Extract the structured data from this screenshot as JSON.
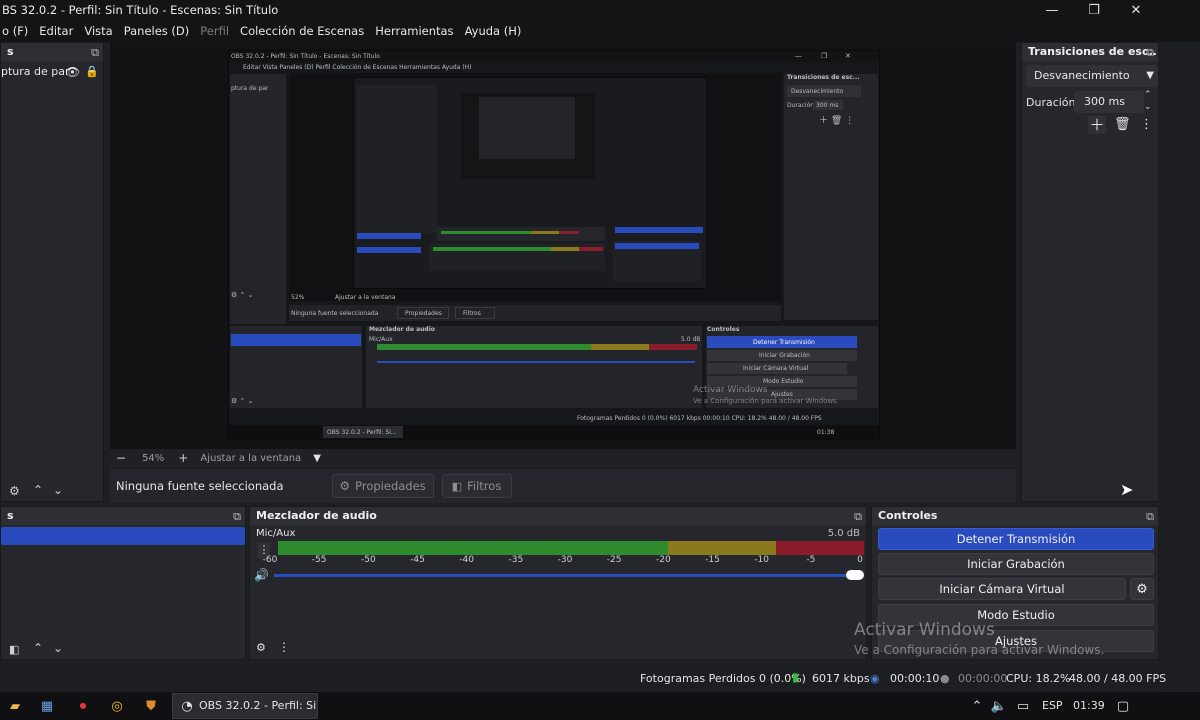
{
  "window": {
    "title": "BS 32.0.2 - Perfil: Sin Título - Escenas: Sin Título",
    "min_glyph": "—",
    "max_glyph": "❐",
    "close_glyph": "✕"
  },
  "menu": [
    {
      "label": "o (F)",
      "disabled": false
    },
    {
      "label": "Editar",
      "disabled": false
    },
    {
      "label": "Vista",
      "disabled": false
    },
    {
      "label": "Paneles (D)",
      "disabled": false
    },
    {
      "label": "Perfil",
      "disabled": true
    },
    {
      "label": "Colección de Escenas",
      "disabled": false
    },
    {
      "label": "Herramientas",
      "disabled": false
    },
    {
      "label": "Ayuda (H)",
      "disabled": false
    }
  ],
  "sources": {
    "header": "s",
    "item_label": "ptura de par"
  },
  "preview": {
    "zoom_minus": "−",
    "zoom_value": "54%",
    "zoom_plus": "+",
    "fit_label": "Ajustar a la ventana"
  },
  "source_toolbar": {
    "no_selection": "Ninguna fuente seleccionada",
    "properties": "Propiedades",
    "filters": "Filtros"
  },
  "transitions": {
    "header": "Transiciones de esc...",
    "selected": "Desvanecimiento",
    "duration_label": "Duración",
    "duration_value": "300 ms"
  },
  "scenes": {
    "header": "s"
  },
  "mixer": {
    "header": "Mezclador de audio",
    "channel": "Mic/Aux",
    "level": "5.0 dB",
    "ticks": [
      "-60",
      "-55",
      "-50",
      "-45",
      "-40",
      "-35",
      "-30",
      "-25",
      "-20",
      "-15",
      "-10",
      "-5",
      "0"
    ]
  },
  "controls": {
    "header": "Controles",
    "stop_stream": "Detener Transmisión",
    "start_recording": "Iniciar Grabación",
    "virtual_cam": "Iniciar Cámara Virtual",
    "studio_mode": "Modo Estudio",
    "settings": "Ajustes"
  },
  "watermark": {
    "line1": "Activar Windows",
    "line2": "Ve a Configuración para activar Windows."
  },
  "status": {
    "dropped": "Fotogramas Perdidos 0 (0.0%)",
    "bitrate": "6017 kbps",
    "stream_time": "00:00:10",
    "rec_time": "00:00:00",
    "cpu": "CPU: 18.2%",
    "fps": "48.00 / 48.00 FPS"
  },
  "taskbar": {
    "app_label": "OBS 32.0.2 - Perfil: Si...",
    "lang": "ESP",
    "time": "01:39"
  },
  "nested": {
    "title": "OBS 32.0.2 - Perfil: Sin Título - Escenas: Sin Título",
    "menu": "Editar   Vista   Paneles (D)   Perfil   Colección de Escenas   Herramientas   Ayuda (H)",
    "transitions": "Transiciones de esc...",
    "fade": "Desvanecimiento",
    "duration": "Duración",
    "duration_value": "300 ms",
    "no_source": "Ninguna fuente seleccionada",
    "props": "Propiedades",
    "filters": "Filtros",
    "mixer": "Mezclador de audio",
    "mic": "Mic/Aux",
    "level": "5.0 dB",
    "controls": "Controles",
    "stop": "Detener Transmisión",
    "rec": "Iniciar Grabación",
    "cam": "Iniciar Cámara Virtual",
    "studio": "Modo Estudio",
    "settings": "Ajustes",
    "status": "Fotogramas Perdidos 0 (0.0%)   6017 kbps   00:00:10   CPU: 18.2%   48.00 / 48.00 FPS",
    "taskbar": "OBS 32.0.2 - Perfil: Si...",
    "time": "01:38",
    "zoom": "52%",
    "fit": "Ajustar a la ventana",
    "source_item": "ptura de par",
    "wm1": "Activar Windows",
    "wm2": "Ve a Configuración para activar Windows"
  },
  "colors": {
    "accent": "#2a4bbd",
    "meter_green": "#2e8b2e",
    "meter_yellow": "#8b7a1d",
    "meter_red": "#8b1d2a"
  }
}
